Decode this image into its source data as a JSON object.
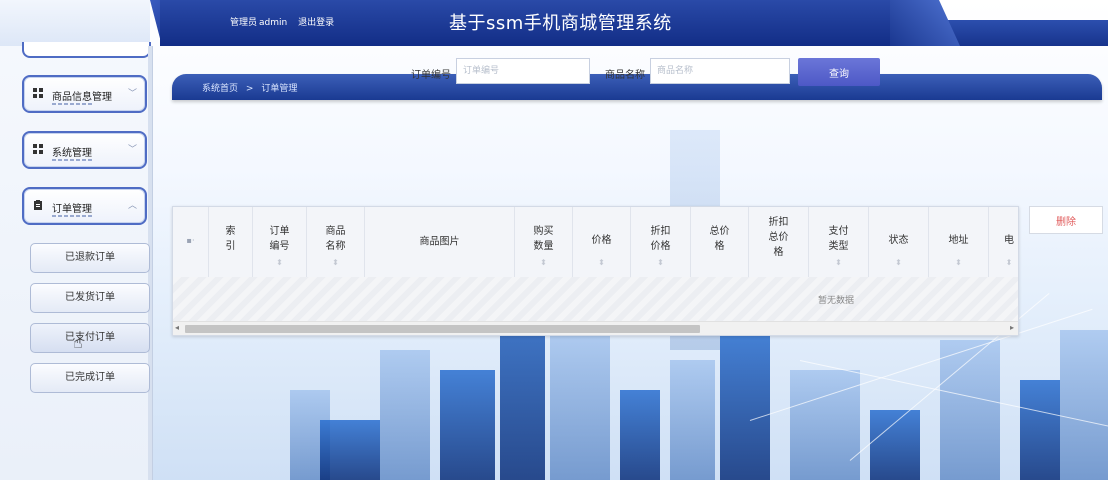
{
  "header": {
    "admin_role": "管理员",
    "admin_name": "admin",
    "logout_label": "退出登录",
    "title": "基于ssm手机商城管理系统"
  },
  "breadcrumb": {
    "home": "系统首页",
    "separator": ">",
    "current": "订单管理"
  },
  "search": {
    "order_no_label": "订单编号",
    "order_no_placeholder": "订单编号",
    "product_name_label": "商品名称",
    "product_name_placeholder": "商品名称",
    "query_label": "查询"
  },
  "sidebar": {
    "menus": [
      {
        "label": "商品信息管理",
        "icon": "grid-icon",
        "expanded": false
      },
      {
        "label": "系统管理",
        "icon": "grid-icon",
        "expanded": false
      },
      {
        "label": "订单管理",
        "icon": "clipboard-icon",
        "expanded": true
      }
    ],
    "sub_items": [
      "已退款订单",
      "已发货订单",
      "已支付订单",
      "已完成订单"
    ]
  },
  "table": {
    "columns": [
      "索\n引",
      "订单\n编号",
      "商品\n名称",
      "商品图片",
      "购买\n数量",
      "价格",
      "折扣\n价格",
      "总价\n格",
      "折扣\n总价\n格",
      "支付\n类型",
      "状态",
      "地址",
      "电"
    ],
    "empty_text": "暂无数据",
    "delete_label": "删除"
  },
  "colors": {
    "header_blue": "#1a3a92",
    "accent": "#4d58c6",
    "danger": "#e05a5a"
  }
}
